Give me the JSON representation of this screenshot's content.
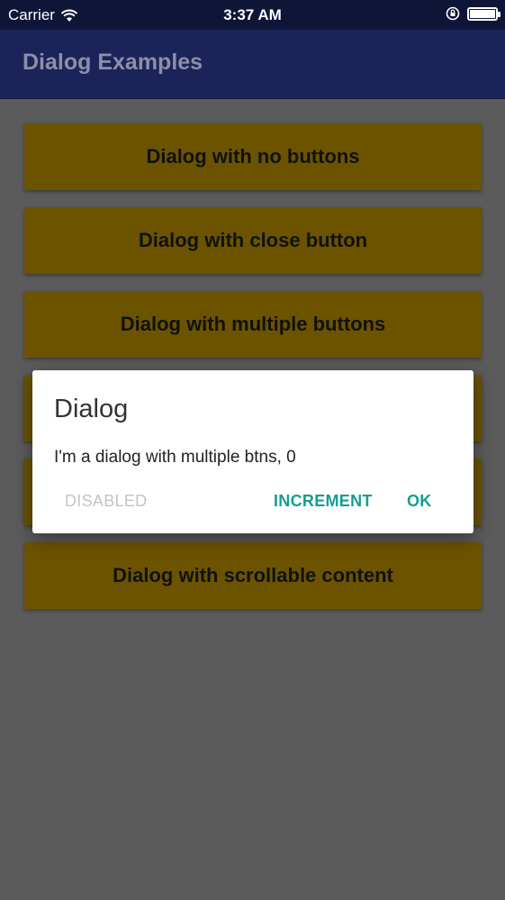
{
  "status_bar": {
    "carrier": "Carrier",
    "time": "3:37 AM"
  },
  "app_bar": {
    "title": "Dialog Examples"
  },
  "buttons": [
    "Dialog with no buttons",
    "Dialog with close button",
    "Dialog with multiple buttons",
    "",
    "",
    "Dialog with scrollable content"
  ],
  "dialog": {
    "title": "Dialog",
    "message": "I'm a dialog with multiple btns, 0",
    "actions": {
      "disabled": "DISABLED",
      "increment": "INCREMENT",
      "ok": "OK"
    }
  },
  "colors": {
    "app_bar": "#1b2458",
    "status_bar": "#0e1537",
    "button_bg": "#6b5300",
    "accent": "#139e92",
    "overlay_bg": "#5b5b5b"
  },
  "icons": [
    "wifi-icon",
    "rotation-lock-icon",
    "battery-icon"
  ]
}
